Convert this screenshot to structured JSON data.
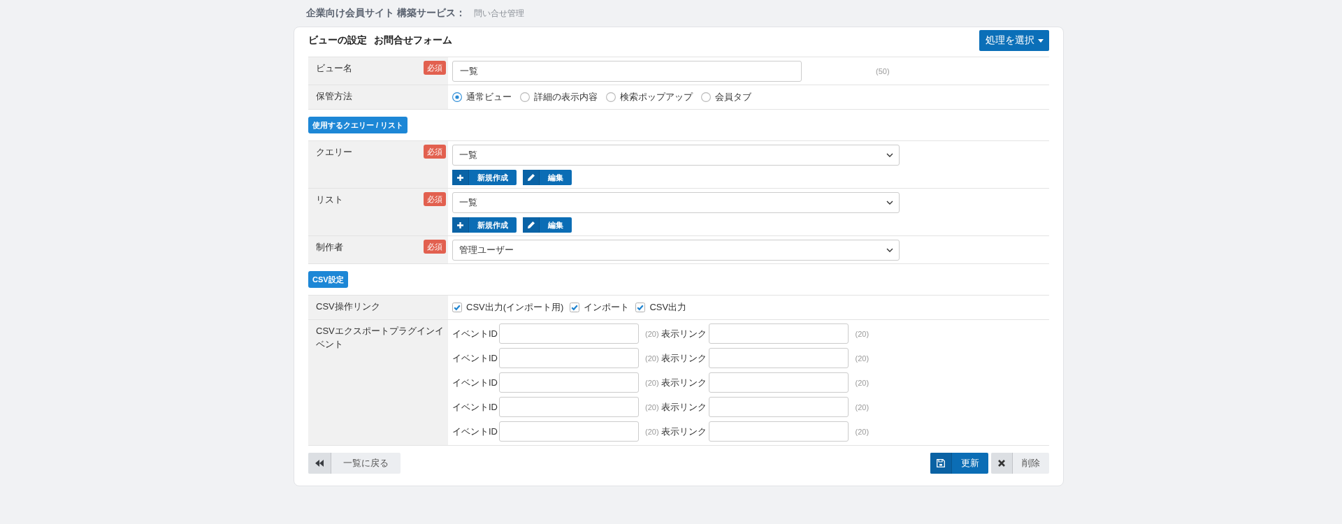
{
  "header": {
    "title": "企業向け会員サイト 構築サービス：",
    "subtitle": "問い合せ管理"
  },
  "panel": {
    "title": "ビューの設定",
    "subtitle": "お問合せフォーム",
    "action_button": "処理を選択"
  },
  "blocks": [
    {
      "kind": "table",
      "rows": [
        {
          "kind": "text",
          "label": "ビュー名",
          "badge": "必須",
          "value": "一覧",
          "limit": "(50)"
        },
        {
          "kind": "radio",
          "label": "保管方法",
          "options": [
            {
              "label": "通常ビュー",
              "selected": true
            },
            {
              "label": "詳細の表示内容",
              "selected": false
            },
            {
              "label": "検索ポップアップ",
              "selected": false
            },
            {
              "label": "会員タブ",
              "selected": false
            }
          ]
        }
      ]
    },
    {
      "kind": "section",
      "label": "使用するクエリー / リスト"
    },
    {
      "kind": "table",
      "rows": [
        {
          "kind": "select",
          "label": "クエリー",
          "badge": "必須",
          "value": "一覧",
          "buttons": [
            {
              "kind": "add",
              "label": "新規作成"
            },
            {
              "kind": "edit",
              "label": "編集"
            }
          ]
        },
        {
          "kind": "select",
          "label": "リスト",
          "badge": "必須",
          "value": "一覧",
          "buttons": [
            {
              "kind": "add",
              "label": "新規作成"
            },
            {
              "kind": "edit",
              "label": "編集"
            }
          ]
        },
        {
          "kind": "select",
          "label": "制作者",
          "badge": "必須",
          "value": "管理ユーザー"
        }
      ]
    },
    {
      "kind": "section",
      "label": "CSV設定"
    },
    {
      "kind": "table",
      "rows": [
        {
          "kind": "checkbox",
          "label": "CSV操作リンク",
          "options": [
            {
              "label": "CSV出力(インポート用)",
              "checked": true
            },
            {
              "label": "インポート",
              "checked": true
            },
            {
              "label": "CSV出力",
              "checked": true
            }
          ]
        },
        {
          "kind": "events",
          "label": "CSVエクスポートプラグインイベント",
          "pairs": [
            {
              "id_label": "イベントID",
              "id_limit": "(20)",
              "link_label": "表示リンク",
              "link_limit": "(20)"
            },
            {
              "id_label": "イベントID",
              "id_limit": "(20)",
              "link_label": "表示リンク",
              "link_limit": "(20)"
            },
            {
              "id_label": "イベントID",
              "id_limit": "(20)",
              "link_label": "表示リンク",
              "link_limit": "(20)"
            },
            {
              "id_label": "イベントID",
              "id_limit": "(20)",
              "link_label": "表示リンク",
              "link_limit": "(20)"
            },
            {
              "id_label": "イベントID",
              "id_limit": "(20)",
              "link_label": "表示リンク",
              "link_limit": "(20)"
            }
          ]
        }
      ]
    }
  ],
  "footer": [
    {
      "kind": "back",
      "label": "一覧に戻る"
    },
    {
      "kind": "save",
      "label": "更新"
    },
    {
      "kind": "delete",
      "label": "削除"
    }
  ]
}
